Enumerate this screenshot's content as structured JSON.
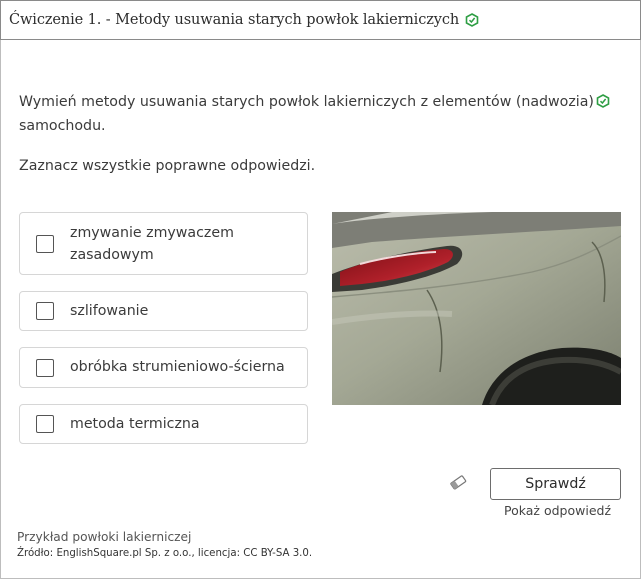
{
  "exercise": {
    "title": "Ćwiczenie 1. - Metody usuwania starych powłok lakierniczych",
    "icon": "green-hexagon-icon"
  },
  "question": {
    "text": "Wymień metody usuwania starych powłok lakierniczych z elementów (nadwozia)",
    "text_cont": "samochodu.",
    "instruction": "Zaznacz wszystkie poprawne odpowiedzi."
  },
  "options": [
    {
      "label_line1": "zmywanie zmywaczem",
      "label_line2": "zasadowym",
      "checked": false
    },
    {
      "label": "szlifowanie",
      "checked": false
    },
    {
      "label": "obróbka strumieniowo-ścierna",
      "checked": false
    },
    {
      "label": "metoda termiczna",
      "checked": false
    }
  ],
  "actions": {
    "check_label": "Sprawdź",
    "show_answer_label": "Pokaż odpowiedź",
    "eraser_icon": "eraser-icon"
  },
  "image": {
    "caption": "Przykład powłoki lakierniczej",
    "source": "Źródło: EnglishSquare.pl Sp. z o.o., licencja: CC BY-SA 3.0."
  },
  "colors": {
    "accent_green": "#2e9e44",
    "border": "#d6d6d6"
  }
}
